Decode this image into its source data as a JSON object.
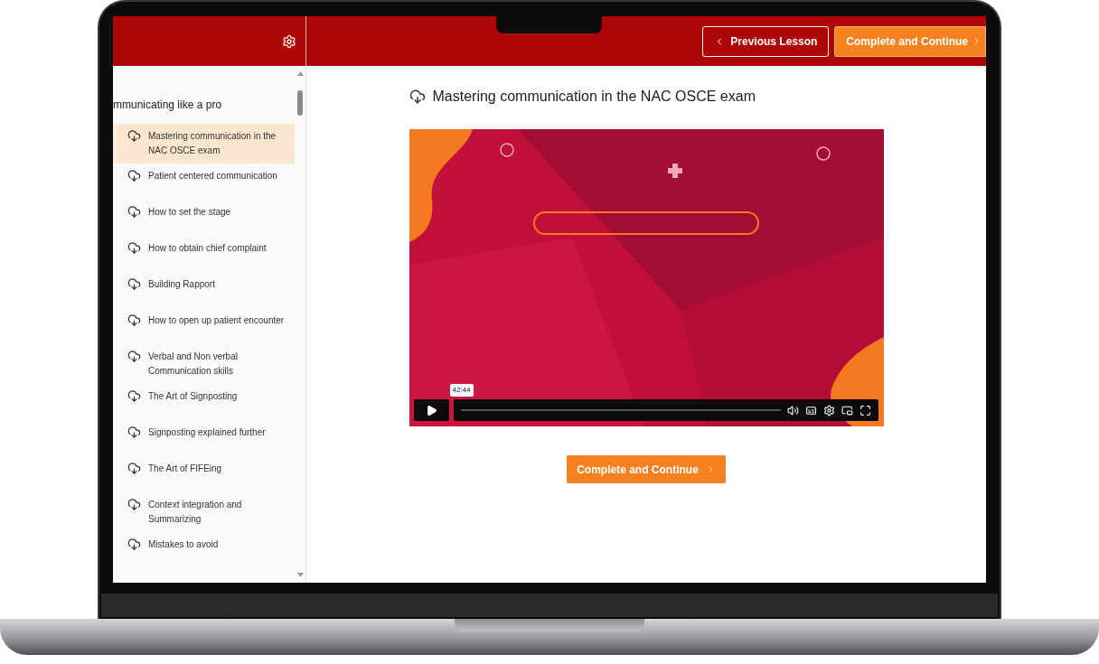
{
  "header": {
    "nav_buttons": [
      {
        "label": "Previous Lesson",
        "kind": "previous"
      },
      {
        "label": "Complete and Continue",
        "kind": "next"
      }
    ]
  },
  "sidebar": {
    "section_title": "mmunicating like a pro",
    "lessons": [
      {
        "title": "Mastering communication in the NAC OSCE exam",
        "selected": true
      },
      {
        "title": "Patient centered communication",
        "selected": false
      },
      {
        "title": "How to set the stage",
        "selected": false
      },
      {
        "title": "How to obtain chief complaint",
        "selected": false
      },
      {
        "title": "Building Rapport",
        "selected": false
      },
      {
        "title": "How to open up patient encounter",
        "selected": false
      },
      {
        "title": "Verbal and Non verbal Communication skills",
        "selected": false
      },
      {
        "title": "The Art of Signposting",
        "selected": false
      },
      {
        "title": "Signposting explained further",
        "selected": false
      },
      {
        "title": "The Art of FIFEing",
        "selected": false
      },
      {
        "title": "Context integration and Summarizing",
        "selected": false
      },
      {
        "title": "Mistakes to avoid",
        "selected": false
      }
    ]
  },
  "lesson": {
    "title": "Mastering communication in the NAC OSCE exam",
    "video": {
      "kind": "picture",
      "time_tooltip": "42:44"
    },
    "complete_button": "Complete and Continue"
  }
}
